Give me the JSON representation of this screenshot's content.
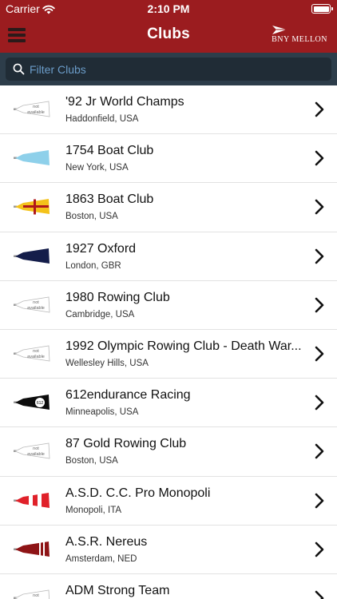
{
  "status_bar": {
    "carrier": "Carrier",
    "time": "2:10 PM"
  },
  "nav": {
    "title": "Clubs",
    "brand": "BNY MELLON"
  },
  "search": {
    "placeholder": "Filter Clubs",
    "value": ""
  },
  "blade_not_available_text": [
    "not",
    "available"
  ],
  "clubs": [
    {
      "name": "'92 Jr World Champs",
      "location": "Haddonfield, USA",
      "blade": "not-available"
    },
    {
      "name": "1754 Boat Club",
      "location": "New York, USA",
      "blade": "light-blue"
    },
    {
      "name": "1863 Boat Club",
      "location": "Boston, USA",
      "blade": "yellow-red-cross"
    },
    {
      "name": "1927 Oxford",
      "location": "London, GBR",
      "blade": "dark-navy"
    },
    {
      "name": "1980 Rowing Club",
      "location": "Cambridge, USA",
      "blade": "not-available"
    },
    {
      "name": "1992 Olympic Rowing Club - Death War...",
      "location": "Wellesley Hills, USA",
      "blade": "not-available"
    },
    {
      "name": "612endurance Racing",
      "location": "Minneapolis, USA",
      "blade": "black-612-logo",
      "blade_text": "612"
    },
    {
      "name": "87 Gold Rowing Club",
      "location": "Boston, USA",
      "blade": "not-available"
    },
    {
      "name": "A.S.D. C.C. Pro Monopoli",
      "location": "Monopoli, ITA",
      "blade": "red-white-stripes"
    },
    {
      "name": "A.S.R. Nereus",
      "location": "Amsterdam, NED",
      "blade": "maroon-white-stripes"
    },
    {
      "name": "ADM Strong Team",
      "location": "",
      "blade": "not-available"
    }
  ],
  "colors": {
    "nav_bg": "#9b1c1f",
    "search_bar_bg": "#2d3d4a",
    "search_field_bg": "#202c36",
    "search_placeholder": "#6b9cc8",
    "separator": "#e2e2e2"
  }
}
